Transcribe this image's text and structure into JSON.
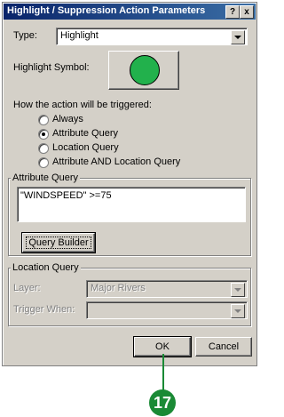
{
  "window": {
    "title": "Highlight / Suppression Action Parameters",
    "help_label": "?",
    "close_label": "x"
  },
  "type_field": {
    "label": "Type:",
    "value": "Highlight"
  },
  "symbol": {
    "label": "Highlight Symbol:",
    "color": "#22b14c"
  },
  "trigger": {
    "label": "How the action will be triggered:",
    "options": [
      "Always",
      "Attribute Query",
      "Location Query",
      "Attribute AND Location Query"
    ],
    "selected_index": 1
  },
  "attribute_query": {
    "group_label": "Attribute Query",
    "text": "\"WINDSPEED\" >=75",
    "builder_label": "Query Builder"
  },
  "location_query": {
    "group_label": "Location Query",
    "layer_label": "Layer:",
    "layer_value": "Major Rivers",
    "trigger_when_label": "Trigger When:",
    "trigger_when_value": ""
  },
  "buttons": {
    "ok": "OK",
    "cancel": "Cancel"
  },
  "callout": {
    "number": "17",
    "color": "#1a8a35"
  }
}
